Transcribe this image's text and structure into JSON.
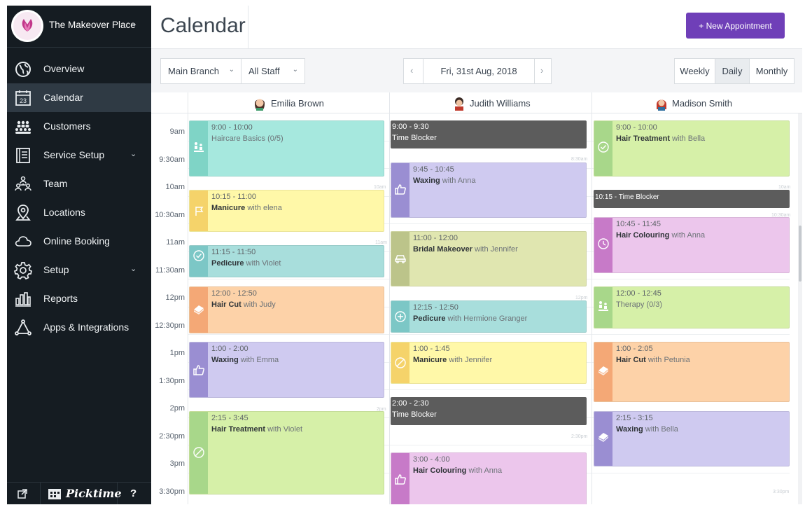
{
  "brand": {
    "name": "The Makeover Place"
  },
  "nav": [
    {
      "label": "Overview",
      "icon": "globe-icon"
    },
    {
      "label": "Calendar",
      "icon": "calendar-icon",
      "active": true,
      "day": "23"
    },
    {
      "label": "Customers",
      "icon": "customers-icon"
    },
    {
      "label": "Service Setup",
      "icon": "list-icon",
      "has_children": true
    },
    {
      "label": "Team",
      "icon": "team-icon"
    },
    {
      "label": "Locations",
      "icon": "location-pin-icon"
    },
    {
      "label": "Online Booking",
      "icon": "cloud-icon"
    },
    {
      "label": "Setup",
      "icon": "gear-icon",
      "has_children": true
    },
    {
      "label": "Reports",
      "icon": "bar-chart-icon"
    },
    {
      "label": "Apps & Integrations",
      "icon": "integrations-icon"
    }
  ],
  "footer": {
    "brand": "Picktime",
    "help": "?"
  },
  "header": {
    "title": "Calendar",
    "new_button": "+ New Appointment"
  },
  "toolbar": {
    "branch": "Main Branch",
    "staff": "All Staff",
    "date": "Fri, 31st Aug, 2018",
    "views": [
      "Weekly",
      "Daily",
      "Monthly"
    ],
    "active_view": "Daily"
  },
  "staff": [
    "Emilia Brown",
    "Judith Williams",
    "Madison Smith"
  ],
  "times": [
    "9am",
    "9:30am",
    "10am",
    "10:30am",
    "11am",
    "11:30am",
    "12pm",
    "12:30pm",
    "1pm",
    "1:30pm",
    "2pm",
    "2:30pm",
    "3pm",
    "3:30pm"
  ],
  "faint_labels": [
    "10am",
    "8:30am",
    "10am",
    "11am",
    "12pm",
    "2pm",
    "2:30pm",
    "3:30pm",
    "10:30am"
  ],
  "appointments": {
    "emilia": [
      {
        "time": "9:00 - 10:00",
        "service": "",
        "rest": "Haircare Basics (0/5)",
        "color": "#a6e8de",
        "strip": "#7fd4c6",
        "icon": "group-service-icon"
      },
      {
        "time": "10:15 - 11:00",
        "service": "Manicure",
        "rest": " with elena",
        "color": "#fff8a8",
        "strip": "#f5d36a",
        "icon": "flag-icon"
      },
      {
        "time": "11:15 - 11:50",
        "service": "Pedicure",
        "rest": " with Violet",
        "color": "#a8dedc",
        "strip": "#7cc7c6",
        "icon": "check-circle-icon"
      },
      {
        "time": "12:00 - 12:50",
        "service": "Hair Cut",
        "rest": " with Judy",
        "color": "#fdd2a8",
        "strip": "#f4a876",
        "icon": "eraser-icon"
      },
      {
        "time": "1:00 - 2:00",
        "service": "Waxing",
        "rest": " with Emma",
        "color": "#cfcaf0",
        "strip": "#9a8ed2",
        "icon": "thumbs-up-icon"
      },
      {
        "time": "2:15 - 3:45",
        "service": "Hair Treatment",
        "rest": " with Violet",
        "color": "#d6f0a8",
        "strip": "#a8d78a",
        "icon": "no-entry-icon"
      }
    ],
    "judith": [
      {
        "time": "9:45 - 10:45",
        "service": "Waxing",
        "rest": " with Anna",
        "color": "#cfcaf0",
        "strip": "#9a8ed2",
        "icon": "thumbs-up-icon"
      },
      {
        "time": "11:00 - 12:00",
        "service": "Bridal Makeover",
        "rest": " with Jennifer",
        "color": "#e0e6b0",
        "strip": "#bcc48a",
        "icon": "car-icon"
      },
      {
        "time": "12:15 - 12:50",
        "service": "Pedicure",
        "rest": " with Hermione Granger",
        "color": "#a8dedc",
        "strip": "#7cc7c6",
        "icon": "plus-circle-icon"
      },
      {
        "time": "1:00 - 1:45",
        "service": "Manicure",
        "rest": " with Jennifer",
        "color": "#fff8a8",
        "strip": "#f5d36a",
        "icon": "no-entry-icon"
      },
      {
        "time": "3:00 - 4:00",
        "service": "Hair Colouring",
        "rest": " with Anna",
        "color": "#ecc6ec",
        "strip": "#c77ac8",
        "icon": "thumbs-up-icon"
      }
    ],
    "judith_blockers": [
      {
        "time": "9:00 - 9:30",
        "desc": "Time Blocker"
      },
      {
        "time": "2:00 - 2:30",
        "desc": "Time Blocker"
      }
    ],
    "madison": [
      {
        "time": "9:00 - 10:00",
        "service": "Hair Treatment",
        "rest": " with Bella",
        "color": "#d6f0a8",
        "strip": "#a8d78a",
        "icon": "check-circle-icon"
      },
      {
        "time": "10:45 - 11:45",
        "service": "Hair Colouring",
        "rest": " with Anna",
        "color": "#ecc6ec",
        "strip": "#c77ac8",
        "icon": "clock-icon"
      },
      {
        "time": "12:00 - 12:45",
        "service": "",
        "rest": "Therapy (0/3)",
        "color": "#d6f0a8",
        "strip": "#a8d78a",
        "icon": "group-service-icon"
      },
      {
        "time": "1:00 - 2:05",
        "service": "Hair Cut",
        "rest": " with Petunia",
        "color": "#fdd2a8",
        "strip": "#f4a876",
        "icon": "eraser-icon"
      },
      {
        "time": "2:15 - 3:15",
        "service": "Waxing",
        "rest": " with Bella",
        "color": "#cfcaf0",
        "strip": "#9a8ed2",
        "icon": "eraser-icon"
      }
    ],
    "madison_blockers": [
      {
        "label": "10:15 - Time Blocker"
      }
    ]
  },
  "colors": {
    "sidebar": "#151c22",
    "accent": "#6f3fb8",
    "blocker": "#5c5c5c"
  }
}
